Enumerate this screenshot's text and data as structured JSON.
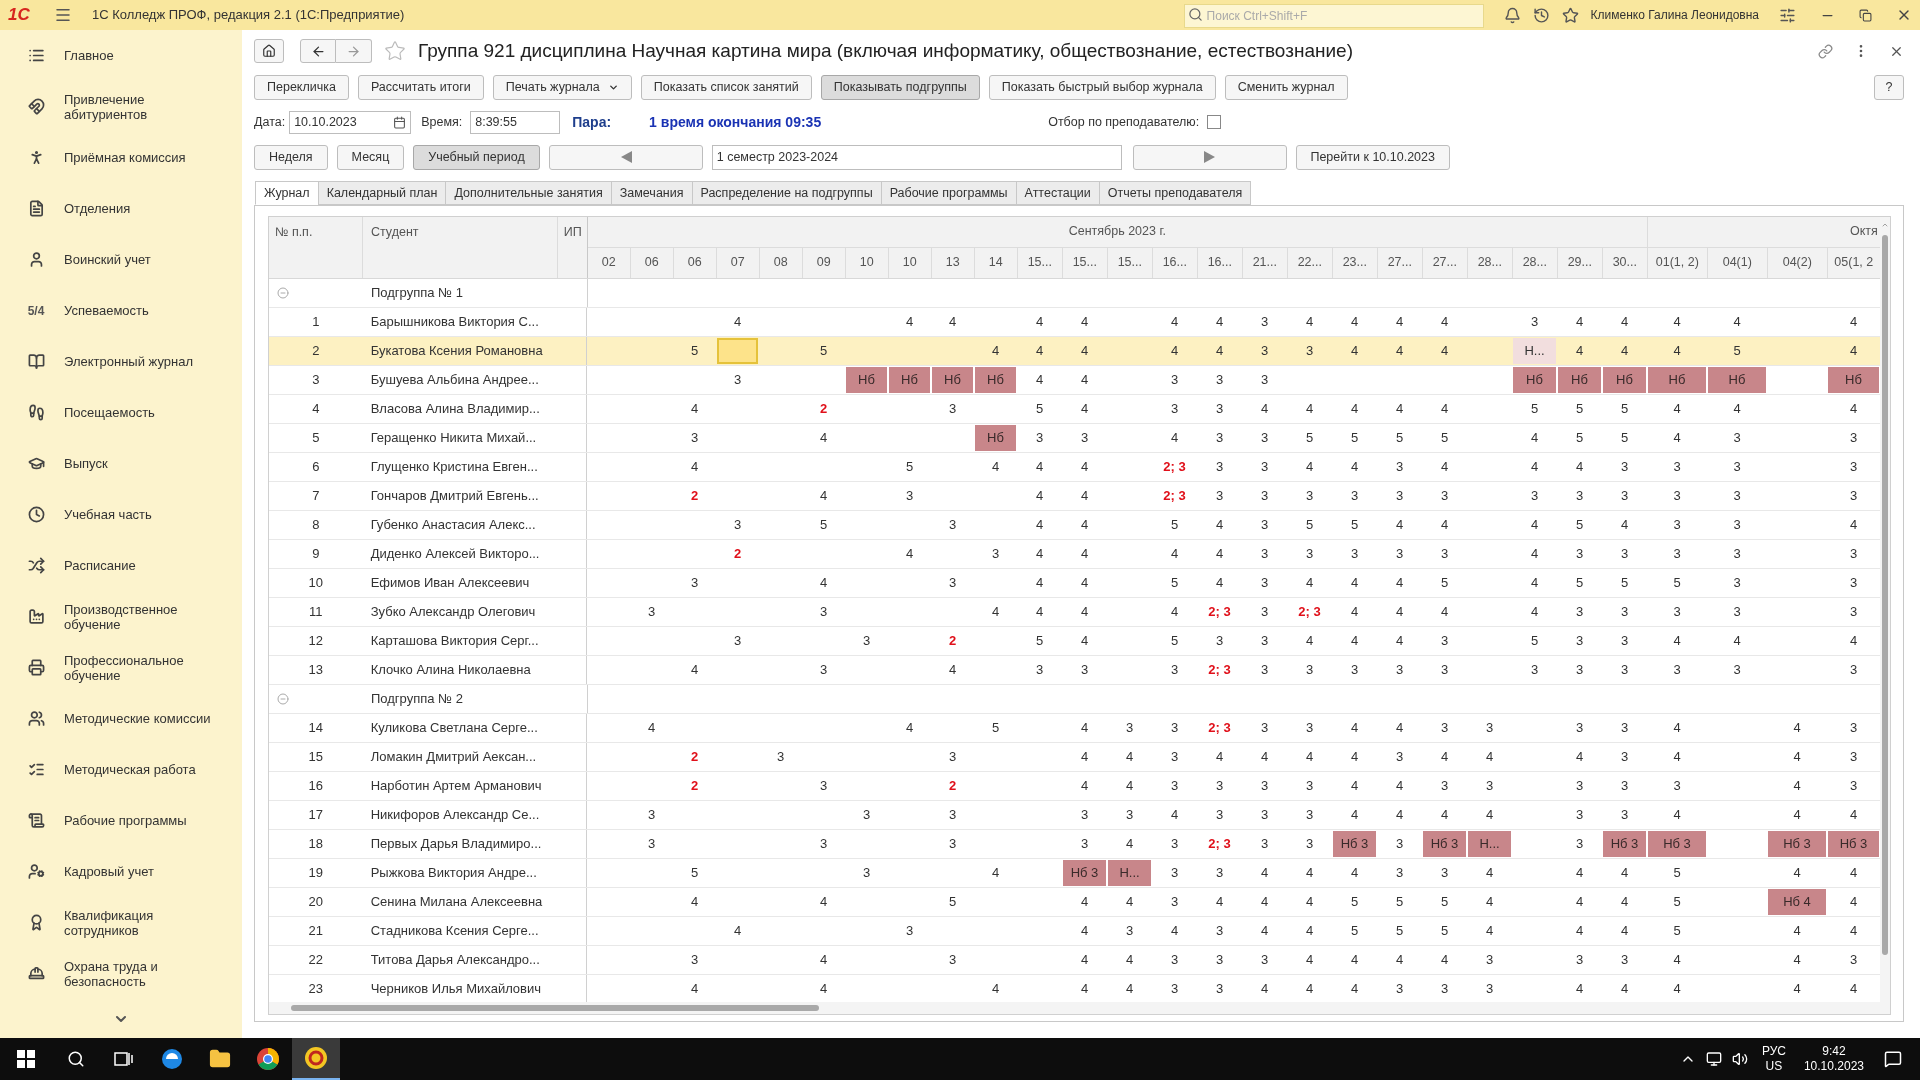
{
  "app_bar": {
    "logo": "1С",
    "title": "1С Колледж ПРОФ, редакция 2.1  (1С:Предприятие)",
    "search": {
      "placeholder": "Поиск Ctrl+Shift+F"
    },
    "user": "Клименко Галина Леонидовна"
  },
  "sidebar": {
    "items": [
      {
        "label": "Главное"
      },
      {
        "label": "Привлечение абитуриентов"
      },
      {
        "label": "Приёмная комиссия"
      },
      {
        "label": "Отделения"
      },
      {
        "label": "Воинский учет"
      },
      {
        "label": "Успеваемость",
        "icon_text": "5/4"
      },
      {
        "label": "Электронный журнал"
      },
      {
        "label": "Посещаемость"
      },
      {
        "label": "Выпуск"
      },
      {
        "label": "Учебная часть"
      },
      {
        "label": "Расписание"
      },
      {
        "label": "Производственное обучение"
      },
      {
        "label": "Профессиональное обучение"
      },
      {
        "label": "Методические комиссии"
      },
      {
        "label": "Методическая работа"
      },
      {
        "label": "Рабочие программы"
      },
      {
        "label": "Кадровый учет"
      },
      {
        "label": "Квалификация сотрудников"
      },
      {
        "label": "Охрана труда и безопасность"
      }
    ]
  },
  "form": {
    "title": "Группа 921 дисциплина Научная картина мира (включая информатику, обществознание, естествознание)",
    "toolbar": [
      {
        "label": "Перекличка",
        "kind": "plain",
        "pressed": false
      },
      {
        "label": "Рассчитать итоги",
        "kind": "plain",
        "pressed": false
      },
      {
        "label": "Печать журнала",
        "kind": "menu",
        "pressed": false
      },
      {
        "label": "Показать список занятий",
        "kind": "plain",
        "pressed": false
      },
      {
        "label": "Показывать подгруппы",
        "kind": "plain",
        "pressed": true
      },
      {
        "label": "Показать быстрый выбор журнала",
        "kind": "plain",
        "pressed": false
      },
      {
        "label": "Сменить журнал",
        "kind": "plain",
        "pressed": false
      }
    ],
    "help": "?",
    "date_label": "Дата:",
    "date": "10.10.2023",
    "time_label": "Время:",
    "time": "8:39:55",
    "pair_label": "Пара:",
    "pair": "1 время окончания 09:35",
    "filter_label": "Отбор по преподавателю:",
    "filter_checked": false,
    "periods": [
      {
        "label": "Неделя",
        "selected": false
      },
      {
        "label": "Месяц",
        "selected": false
      },
      {
        "label": "Учебный период",
        "selected": true
      }
    ],
    "period_value": "1 семестр 2023-2024",
    "goto": "Перейти к 10.10.2023",
    "tabs": [
      {
        "label": "Журнал",
        "selected": true
      },
      {
        "label": "Календарный план",
        "selected": false
      },
      {
        "label": "Дополнительные занятия",
        "selected": false
      },
      {
        "label": "Замечания",
        "selected": false
      },
      {
        "label": "Распределение на подгруппы",
        "selected": false
      },
      {
        "label": "Рабочие программы",
        "selected": false
      },
      {
        "label": "Аттестации",
        "selected": false
      },
      {
        "label": "Отчеты преподавателя",
        "selected": false
      }
    ]
  },
  "table": {
    "columns": [
      "№ п.п.",
      "Студент",
      "ИП"
    ],
    "months": [
      {
        "label": "Сентябрь 2023 г.",
        "dates": [
          "02",
          "06",
          "06",
          "07",
          "08",
          "09",
          "10",
          "10",
          "13",
          "14",
          "15...",
          "15...",
          "15...",
          "16...",
          "16...",
          "21...",
          "22...",
          "23...",
          "27...",
          "27...",
          "28...",
          "28...",
          "29...",
          "30..."
        ]
      },
      {
        "label": "Октя",
        "dates": [
          "01(1, 2)",
          "04(1)",
          "04(2)",
          "05(1, 2"
        ]
      }
    ],
    "rows": [
      {
        "kind": "group",
        "label": "Подгруппа № 1",
        "expanded": true,
        "selected": false
      },
      {
        "kind": "student",
        "number": "1",
        "name": "Барышникова Виктория С...",
        "selected": false,
        "cells": [
          null,
          null,
          null,
          "4",
          null,
          null,
          null,
          "4",
          "4",
          null,
          "4",
          "4",
          null,
          "4",
          "4",
          "3",
          "4",
          "4",
          "4",
          "4",
          null,
          "3",
          "4",
          "4",
          "4",
          "4",
          null,
          "4"
        ]
      },
      {
        "kind": "student",
        "number": "2",
        "name": "Букатова Ксения Романовна",
        "selected": true,
        "cells": [
          null,
          null,
          "5",
          {
            "kind": "cursor"
          },
          null,
          "5",
          null,
          null,
          null,
          "4",
          "4",
          "4",
          null,
          "4",
          "4",
          "3",
          "3",
          "4",
          "4",
          "4",
          null,
          {
            "text": "Н...",
            "kind": "faint"
          },
          "4",
          "4",
          "4",
          "5",
          null,
          "4"
        ]
      },
      {
        "kind": "student",
        "number": "3",
        "name": "Бушуева Альбина Андрее...",
        "selected": false,
        "cells": [
          null,
          null,
          null,
          "3",
          null,
          null,
          {
            "text": "Нб",
            "kind": "absence"
          },
          {
            "text": "Нб",
            "kind": "absence"
          },
          {
            "text": "Нб",
            "kind": "absence"
          },
          {
            "text": "Нб",
            "kind": "absence"
          },
          "4",
          "4",
          null,
          "3",
          "3",
          "3",
          null,
          null,
          null,
          null,
          null,
          {
            "text": "Нб",
            "kind": "absence"
          },
          {
            "text": "Нб",
            "kind": "absence"
          },
          {
            "text": "Нб",
            "kind": "absence"
          },
          {
            "text": "Нб",
            "kind": "absence"
          },
          {
            "text": "Нб",
            "kind": "absence"
          },
          null,
          {
            "text": "Нб",
            "kind": "absence"
          }
        ]
      },
      {
        "kind": "student",
        "number": "4",
        "name": "Власова Алина Владимир...",
        "selected": false,
        "cells": [
          null,
          null,
          "4",
          null,
          null,
          {
            "text": "2",
            "kind": "fail"
          },
          null,
          null,
          "3",
          null,
          "5",
          "4",
          null,
          "3",
          "3",
          "4",
          "4",
          "4",
          "4",
          "4",
          null,
          "5",
          "5",
          "5",
          "4",
          "4",
          null,
          "4"
        ]
      },
      {
        "kind": "student",
        "number": "5",
        "name": "Геращенко Никита Михай...",
        "selected": false,
        "cells": [
          null,
          null,
          "3",
          null,
          null,
          "4",
          null,
          null,
          null,
          {
            "text": "Нб",
            "kind": "absence"
          },
          "3",
          "3",
          null,
          "4",
          "3",
          "3",
          "5",
          "5",
          "5",
          "5",
          null,
          "4",
          "5",
          "5",
          "4",
          "3",
          null,
          "3"
        ]
      },
      {
        "kind": "student",
        "number": "6",
        "name": "Глущенко Кристина Евген...",
        "selected": false,
        "cells": [
          null,
          null,
          "4",
          null,
          null,
          null,
          null,
          "5",
          null,
          "4",
          "4",
          "4",
          null,
          {
            "text": "2; 3",
            "kind": "fail"
          },
          "3",
          "3",
          "4",
          "4",
          "3",
          "4",
          null,
          "4",
          "4",
          "3",
          "3",
          "3",
          null,
          "3"
        ]
      },
      {
        "kind": "student",
        "number": "7",
        "name": "Гончаров Дмитрий Евгень...",
        "selected": false,
        "cells": [
          null,
          null,
          {
            "text": "2",
            "kind": "fail"
          },
          null,
          null,
          "4",
          null,
          "3",
          null,
          null,
          "4",
          "4",
          null,
          {
            "text": "2; 3",
            "kind": "fail"
          },
          "3",
          "3",
          "3",
          "3",
          "3",
          "3",
          null,
          "3",
          "3",
          "3",
          "3",
          "3",
          null,
          "3"
        ]
      },
      {
        "kind": "student",
        "number": "8",
        "name": "Губенко Анастасия Алекс...",
        "selected": false,
        "cells": [
          null,
          null,
          null,
          "3",
          null,
          "5",
          null,
          null,
          "3",
          null,
          "4",
          "4",
          null,
          "5",
          "4",
          "3",
          "5",
          "5",
          "4",
          "4",
          null,
          "4",
          "5",
          "4",
          "3",
          "3",
          null,
          "4"
        ]
      },
      {
        "kind": "student",
        "number": "9",
        "name": "Диденко Алексей Викторо...",
        "selected": false,
        "cells": [
          null,
          null,
          null,
          {
            "text": "2",
            "kind": "fail"
          },
          null,
          null,
          null,
          "4",
          null,
          "3",
          "4",
          "4",
          null,
          "4",
          "4",
          "3",
          "3",
          "3",
          "3",
          "3",
          null,
          "4",
          "3",
          "3",
          "3",
          "3",
          null,
          "3"
        ]
      },
      {
        "kind": "student",
        "number": "10",
        "name": "Ефимов Иван Алексеевич",
        "selected": false,
        "cells": [
          null,
          null,
          "3",
          null,
          null,
          "4",
          null,
          null,
          "3",
          null,
          "4",
          "4",
          null,
          "5",
          "4",
          "3",
          "4",
          "4",
          "4",
          "5",
          null,
          "4",
          "5",
          "5",
          "5",
          "3",
          null,
          "3"
        ]
      },
      {
        "kind": "student",
        "number": "11",
        "name": "Зубко Александр Олегович",
        "selected": false,
        "cells": [
          null,
          "3",
          null,
          null,
          null,
          "3",
          null,
          null,
          null,
          "4",
          "4",
          "4",
          null,
          "4",
          {
            "text": "2; 3",
            "kind": "fail"
          },
          "3",
          {
            "text": "2; 3",
            "kind": "fail"
          },
          "4",
          "4",
          "4",
          null,
          "4",
          "3",
          "3",
          "3",
          "3",
          null,
          "3"
        ]
      },
      {
        "kind": "student",
        "number": "12",
        "name": "Карташова Виктория Серг...",
        "selected": false,
        "cells": [
          null,
          null,
          null,
          "3",
          null,
          null,
          "3",
          null,
          {
            "text": "2",
            "kind": "fail"
          },
          null,
          "5",
          "4",
          null,
          "5",
          "3",
          "3",
          "4",
          "4",
          "4",
          "3",
          null,
          "5",
          "3",
          "3",
          "4",
          "4",
          null,
          "4"
        ]
      },
      {
        "kind": "student",
        "number": "13",
        "name": "Клочко Алина Николаевна",
        "selected": false,
        "cells": [
          null,
          null,
          "4",
          null,
          null,
          "3",
          null,
          null,
          "4",
          null,
          "3",
          "3",
          null,
          "3",
          {
            "text": "2; 3",
            "kind": "fail"
          },
          "3",
          "3",
          "3",
          "3",
          "3",
          null,
          "3",
          "3",
          "3",
          "3",
          "3",
          null,
          "3"
        ]
      },
      {
        "kind": "group",
        "label": "Подгруппа № 2",
        "expanded": true,
        "selected": false
      },
      {
        "kind": "student",
        "number": "14",
        "name": "Куликова Светлана Серге...",
        "selected": false,
        "cells": [
          null,
          "4",
          null,
          null,
          null,
          null,
          null,
          "4",
          null,
          "5",
          null,
          "4",
          "3",
          "3",
          {
            "text": "2; 3",
            "kind": "fail"
          },
          "3",
          "3",
          "4",
          "4",
          "3",
          "3",
          null,
          "3",
          "3",
          "4",
          null,
          "4",
          "3"
        ]
      },
      {
        "kind": "student",
        "number": "15",
        "name": "Ломакин Дмитрий Аексан...",
        "selected": false,
        "cells": [
          null,
          null,
          {
            "text": "2",
            "kind": "fail"
          },
          null,
          "3",
          null,
          null,
          null,
          "3",
          null,
          null,
          "4",
          "4",
          "3",
          "4",
          "4",
          "4",
          "4",
          "3",
          "4",
          "4",
          null,
          "4",
          "3",
          "4",
          null,
          "4",
          "3"
        ]
      },
      {
        "kind": "student",
        "number": "16",
        "name": "Нарботин Артем Арманович",
        "selected": false,
        "cells": [
          null,
          null,
          {
            "text": "2",
            "kind": "fail"
          },
          null,
          null,
          "3",
          null,
          null,
          {
            "text": "2",
            "kind": "fail"
          },
          null,
          null,
          "4",
          "4",
          "3",
          "3",
          "3",
          "3",
          "4",
          "4",
          "3",
          "3",
          null,
          "3",
          "3",
          "3",
          null,
          "4",
          "3"
        ]
      },
      {
        "kind": "student",
        "number": "17",
        "name": "Никифоров Александр Се...",
        "selected": false,
        "cells": [
          null,
          "3",
          null,
          null,
          null,
          null,
          "3",
          null,
          "3",
          null,
          null,
          "3",
          "3",
          "4",
          "3",
          "3",
          "3",
          "4",
          "4",
          "4",
          "4",
          null,
          "3",
          "3",
          "4",
          null,
          "4",
          "4"
        ]
      },
      {
        "kind": "student",
        "number": "18",
        "name": "Первых Дарья Владимиро...",
        "selected": false,
        "cells": [
          null,
          "3",
          null,
          null,
          null,
          "3",
          null,
          null,
          "3",
          null,
          null,
          "3",
          "4",
          "3",
          {
            "text": "2; 3",
            "kind": "fail"
          },
          "3",
          "3",
          {
            "text": "Нб 3",
            "kind": "absence"
          },
          "3",
          {
            "text": "Нб 3",
            "kind": "absence"
          },
          {
            "text": "Н...",
            "kind": "absence"
          },
          null,
          "3",
          {
            "text": "Нб 3",
            "kind": "absence"
          },
          {
            "text": "Нб 3",
            "kind": "absence"
          },
          null,
          {
            "text": "Нб 3",
            "kind": "absence"
          },
          {
            "text": "Нб 3",
            "kind": "absence"
          }
        ]
      },
      {
        "kind": "student",
        "number": "19",
        "name": "Рыжкова Виктория Андре...",
        "selected": false,
        "cells": [
          null,
          null,
          "5",
          null,
          null,
          null,
          "3",
          null,
          null,
          "4",
          null,
          {
            "text": "Нб 3",
            "kind": "absence"
          },
          {
            "text": "Н...",
            "kind": "absence"
          },
          "3",
          "3",
          "4",
          "4",
          "4",
          "3",
          "3",
          "4",
          null,
          "4",
          "4",
          "5",
          null,
          "4",
          "4"
        ]
      },
      {
        "kind": "student",
        "number": "20",
        "name": "Сенина Милана Алексеевна",
        "selected": false,
        "cells": [
          null,
          null,
          "4",
          null,
          null,
          "4",
          null,
          null,
          "5",
          null,
          null,
          "4",
          "4",
          "3",
          "4",
          "4",
          "4",
          "5",
          "5",
          "5",
          "4",
          null,
          "4",
          "4",
          "5",
          null,
          {
            "text": "Нб 4",
            "kind": "absence"
          },
          "4"
        ]
      },
      {
        "kind": "student",
        "number": "21",
        "name": "Стадникова Ксения Серге...",
        "selected": false,
        "cells": [
          null,
          null,
          null,
          "4",
          null,
          null,
          null,
          "3",
          null,
          null,
          null,
          "4",
          "3",
          "4",
          "3",
          "4",
          "4",
          "5",
          "5",
          "5",
          "4",
          null,
          "4",
          "4",
          "5",
          null,
          "4",
          "4"
        ]
      },
      {
        "kind": "student",
        "number": "22",
        "name": "Титова Дарья Александро...",
        "selected": false,
        "cells": [
          null,
          null,
          "3",
          null,
          null,
          "4",
          null,
          null,
          "3",
          null,
          null,
          "4",
          "4",
          "3",
          "3",
          "3",
          "4",
          "4",
          "4",
          "4",
          "3",
          null,
          "3",
          "3",
          "4",
          null,
          "4",
          "3"
        ]
      },
      {
        "kind": "student",
        "number": "23",
        "name": "Черников Илья Михайлович",
        "selected": false,
        "cells": [
          null,
          null,
          "4",
          null,
          null,
          "4",
          null,
          null,
          null,
          "4",
          null,
          "4",
          "4",
          "3",
          "3",
          "4",
          "4",
          "4",
          "3",
          "3",
          "3",
          null,
          "4",
          "4",
          "4",
          null,
          "4",
          "4"
        ]
      }
    ]
  },
  "taskbar": {
    "language": "РУС",
    "layout": "US",
    "time": "9:42",
    "date": "10.10.2023"
  }
}
